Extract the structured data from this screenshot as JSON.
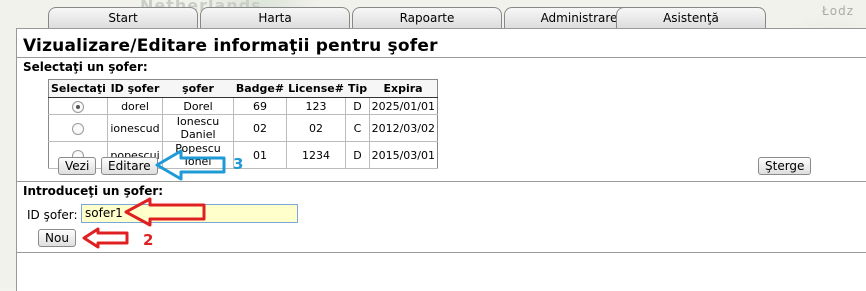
{
  "map": {
    "labels": [
      "Netherlands",
      "Łodz"
    ]
  },
  "tabs": [
    {
      "label": "Start"
    },
    {
      "label": "Harta"
    },
    {
      "label": "Rapoarte"
    },
    {
      "label": "Administrare"
    },
    {
      "label": "Asistenţă"
    }
  ],
  "page_title": "Vizualizare/Editare informaţii pentru şofer",
  "select_section": {
    "label": "Selectaţi un şofer:",
    "columns": [
      "Selectaţi",
      "ID şofer",
      "şofer",
      "Badge#",
      "License#",
      "Tip",
      "Expira"
    ],
    "rows": [
      {
        "selected": true,
        "id": "dorel",
        "name": "Dorel",
        "badge": "69",
        "license": "123",
        "tip": "D",
        "expira": "2025/01/01"
      },
      {
        "selected": false,
        "id": "ionescud",
        "name": "Ionescu Daniel",
        "badge": "02",
        "license": "02",
        "tip": "C",
        "expira": "2012/03/02"
      },
      {
        "selected": false,
        "id": "popescui",
        "name": "Popescu Ionel",
        "badge": "01",
        "license": "1234",
        "tip": "D",
        "expira": "2015/03/01"
      }
    ],
    "buttons": {
      "view": "Vezi",
      "edit": "Editare",
      "delete": "Şterge"
    }
  },
  "enter_section": {
    "label": "Introduceţi un şofer:",
    "field_label": "ID şofer:",
    "field_value": "sofer1",
    "new_button": "Nou"
  },
  "annotations": [
    {
      "number": "3",
      "color": "#1e9ad6"
    },
    {
      "number": "2",
      "color": "#e02020"
    }
  ]
}
